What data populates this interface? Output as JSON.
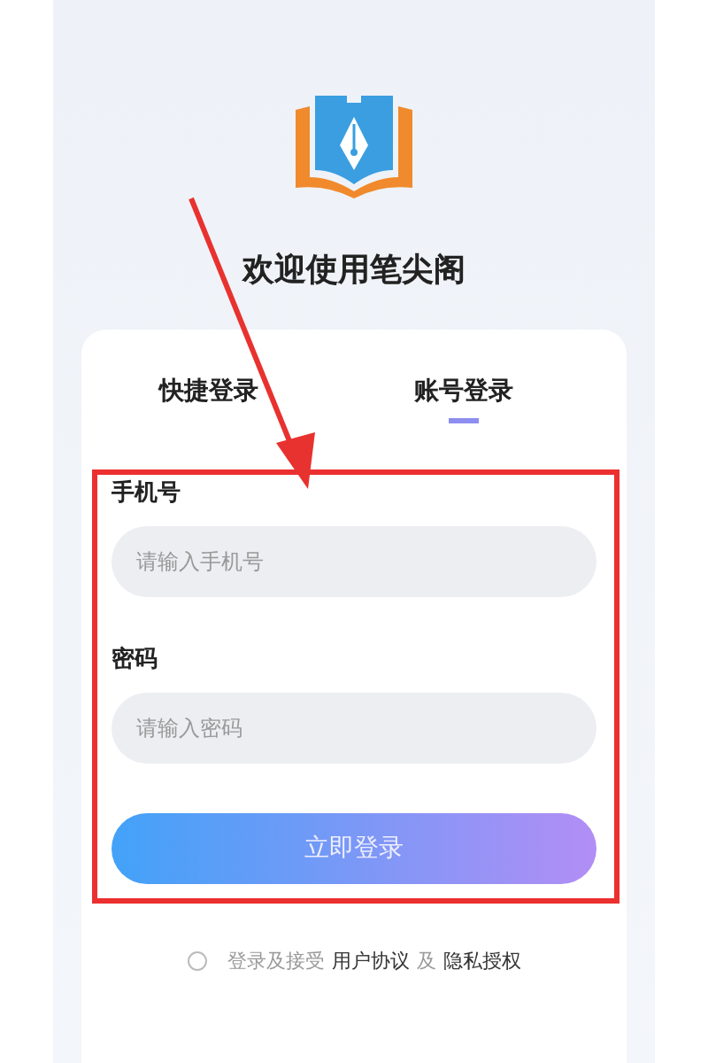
{
  "title": "欢迎使用笔尖阁",
  "tabs": [
    {
      "label": "快捷登录",
      "selected": false
    },
    {
      "label": "账号登录",
      "selected": true
    }
  ],
  "fields": [
    {
      "label": "手机号",
      "placeholder": "请输入手机号"
    },
    {
      "label": "密码",
      "placeholder": "请输入密码"
    }
  ],
  "submit": "立即登录",
  "agreement": {
    "checked": false,
    "prefix": "登录及接受",
    "link1": "用户协议",
    "joiner": "及",
    "link2": "隐私授权"
  }
}
